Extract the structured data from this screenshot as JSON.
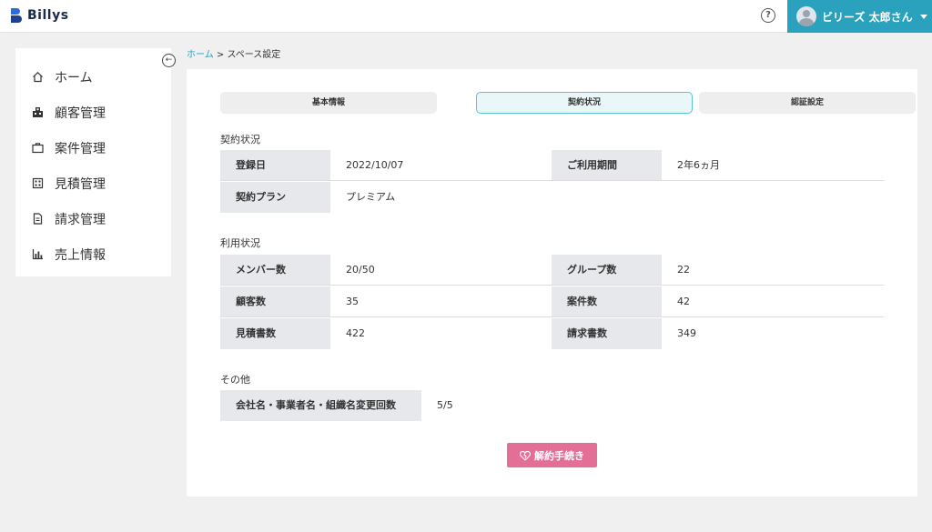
{
  "app": {
    "logo_text": "Billys"
  },
  "header": {
    "help_icon": "question-circle-icon",
    "user_name": "ビリーズ 太郎さん"
  },
  "sidebar": {
    "items": [
      {
        "label": "ホーム",
        "icon": "home-icon"
      },
      {
        "label": "顧客管理",
        "icon": "building-icon"
      },
      {
        "label": "案件管理",
        "icon": "briefcase-icon"
      },
      {
        "label": "見積管理",
        "icon": "calculator-icon"
      },
      {
        "label": "請求管理",
        "icon": "document-icon"
      },
      {
        "label": "売上情報",
        "icon": "bar-chart-icon"
      }
    ]
  },
  "breadcrumb": {
    "home": "ホーム",
    "separator": " > ",
    "current": "スペース設定"
  },
  "tabs": [
    {
      "label": "基本情報",
      "active": false
    },
    {
      "label": "契約状況",
      "active": true
    },
    {
      "label": "認証設定",
      "active": false
    }
  ],
  "contract": {
    "title": "契約状況",
    "registered_label": "登録日",
    "registered_value": "2022/10/07",
    "period_label": "ご利用期間",
    "period_value": "2年6ヵ月",
    "plan_label": "契約プラン",
    "plan_value": "プレミアム"
  },
  "usage": {
    "title": "利用状況",
    "members_label": "メンバー数",
    "members_value": "20/50",
    "groups_label": "グループ数",
    "groups_value": "22",
    "customers_label": "顧客数",
    "customers_value": "35",
    "projects_label": "案件数",
    "projects_value": "42",
    "estimates_label": "見積書数",
    "estimates_value": "422",
    "invoices_label": "請求書数",
    "invoices_value": "349"
  },
  "other": {
    "title": "その他",
    "rename_label": "会社名・事業者名・組織名変更回数",
    "rename_value": "5/5"
  },
  "cancel_button": {
    "label": "解約手続き",
    "color": "#e46f96"
  },
  "colors": {
    "accent": "#2aa1bd",
    "tab_active_border": "#5bc1d6"
  }
}
